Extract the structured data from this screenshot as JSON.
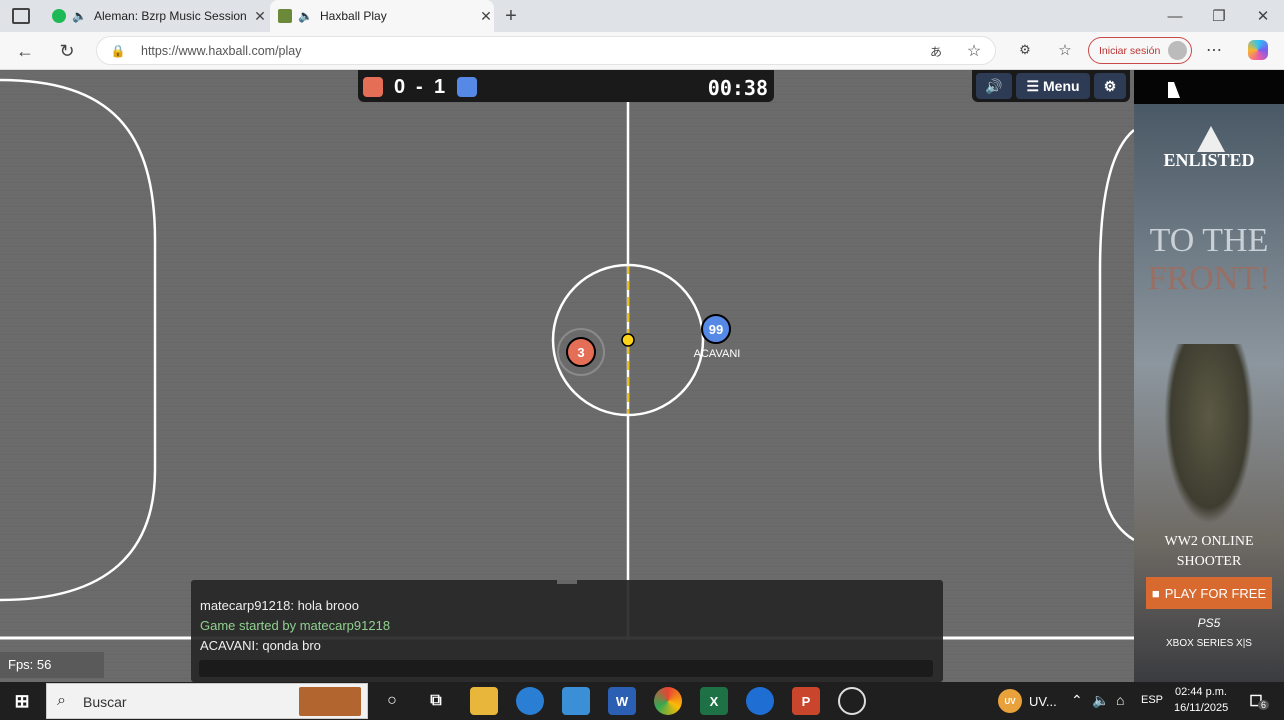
{
  "browser": {
    "tabs": [
      {
        "title": "Aleman: Bzrp Music Session",
        "active": false
      },
      {
        "title": "Haxball Play",
        "active": true
      }
    ],
    "url": "https://www.haxball.com/play",
    "login_label": "Iniciar sesión"
  },
  "game": {
    "score_red": "0",
    "score_sep": "-",
    "score_blue": "1",
    "timer": "00:38",
    "menu_label": "Menu",
    "players": [
      {
        "number": "3",
        "team": "red",
        "name": ""
      },
      {
        "number": "99",
        "team": "blue",
        "name": "ACAVANI"
      }
    ],
    "fps": "Fps: 56",
    "colors": {
      "red": "#e56e56",
      "blue": "#5689e5",
      "field": "#6c6c6c",
      "ball": "#ffd21a"
    }
  },
  "chat": {
    "messages": [
      {
        "text": "matecarp91218: hola brooo",
        "system": false
      },
      {
        "text": "Game started by matecarp91218",
        "system": true
      },
      {
        "text": "ACAVANI: qonda bro",
        "system": false
      }
    ]
  },
  "ad": {
    "brand": "ENLISTED",
    "headline1": "TO THE",
    "headline2": "FRONT!",
    "tagline1": "WW2 ONLINE",
    "tagline2": "SHOOTER",
    "cta": "PLAY FOR FREE",
    "platform1": "PS5",
    "platform2": "XBOX SERIES X|S"
  },
  "taskbar": {
    "search_label": "Buscar",
    "weather": "UV...",
    "lang": "ESP",
    "time": "02:44 p.m.",
    "date": "16/11/2025",
    "notif_count": "6"
  }
}
